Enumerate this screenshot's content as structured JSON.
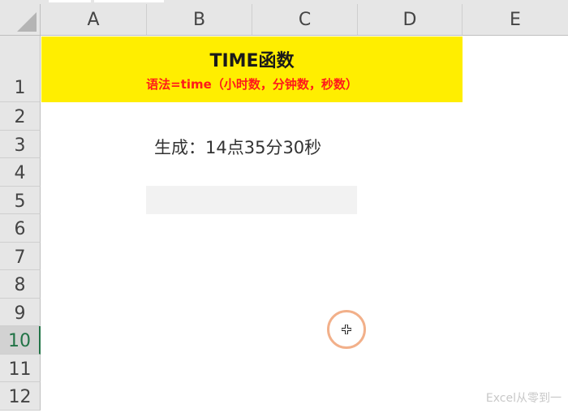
{
  "columns": [
    "A",
    "B",
    "C",
    "D",
    "E"
  ],
  "rows": [
    "1",
    "2",
    "3",
    "4",
    "5",
    "6",
    "7",
    "8",
    "9",
    "10",
    "11",
    "12"
  ],
  "active_row": "10",
  "banner": {
    "title": "TIME函数",
    "syntax": "语法=time（小时数，分钟数，秒数）"
  },
  "cell_b3": "生成：14点35分30秒",
  "watermark": "Excel从零到一",
  "colors": {
    "banner_bg": "#ffee00",
    "syntax_text": "#ff1a1a",
    "cursor_ring": "#f2b08a",
    "active_row_accent": "#217346"
  },
  "icons": [
    "select-all-corner-icon",
    "cursor-crosshair-icon"
  ]
}
